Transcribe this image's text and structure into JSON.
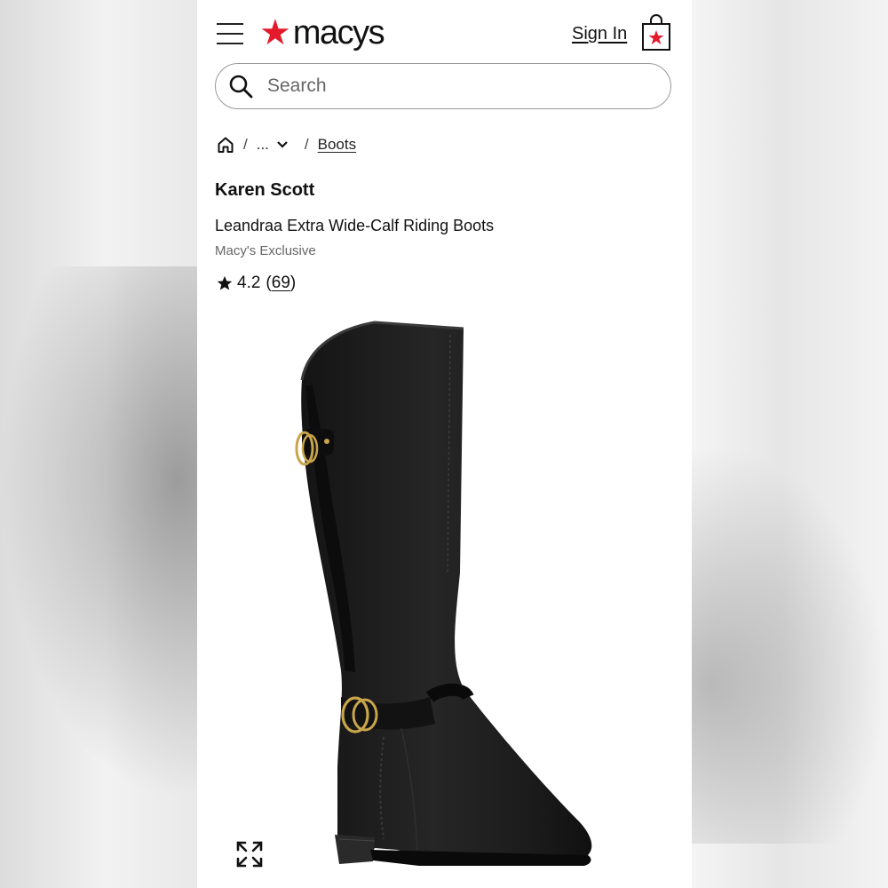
{
  "header": {
    "logo_text": "macys",
    "signin_label": "Sign In",
    "icons": {
      "menu": "hamburger-icon",
      "bag": "shopping-bag-icon",
      "star": "macys-star-icon"
    }
  },
  "search": {
    "placeholder": "Search",
    "value": ""
  },
  "breadcrumb": {
    "home_icon": "home-icon",
    "ellipsis": "...",
    "separator": "/",
    "current": "Boots"
  },
  "product": {
    "brand": "Karen Scott",
    "name": "Leandraa Extra Wide-Calf Riding Boots",
    "exclusive": "Macy's Exclusive",
    "rating": "4.2",
    "review_count": "69"
  },
  "colors": {
    "brand_red": "#e21a2c",
    "text": "#111111",
    "muted": "#666666"
  }
}
